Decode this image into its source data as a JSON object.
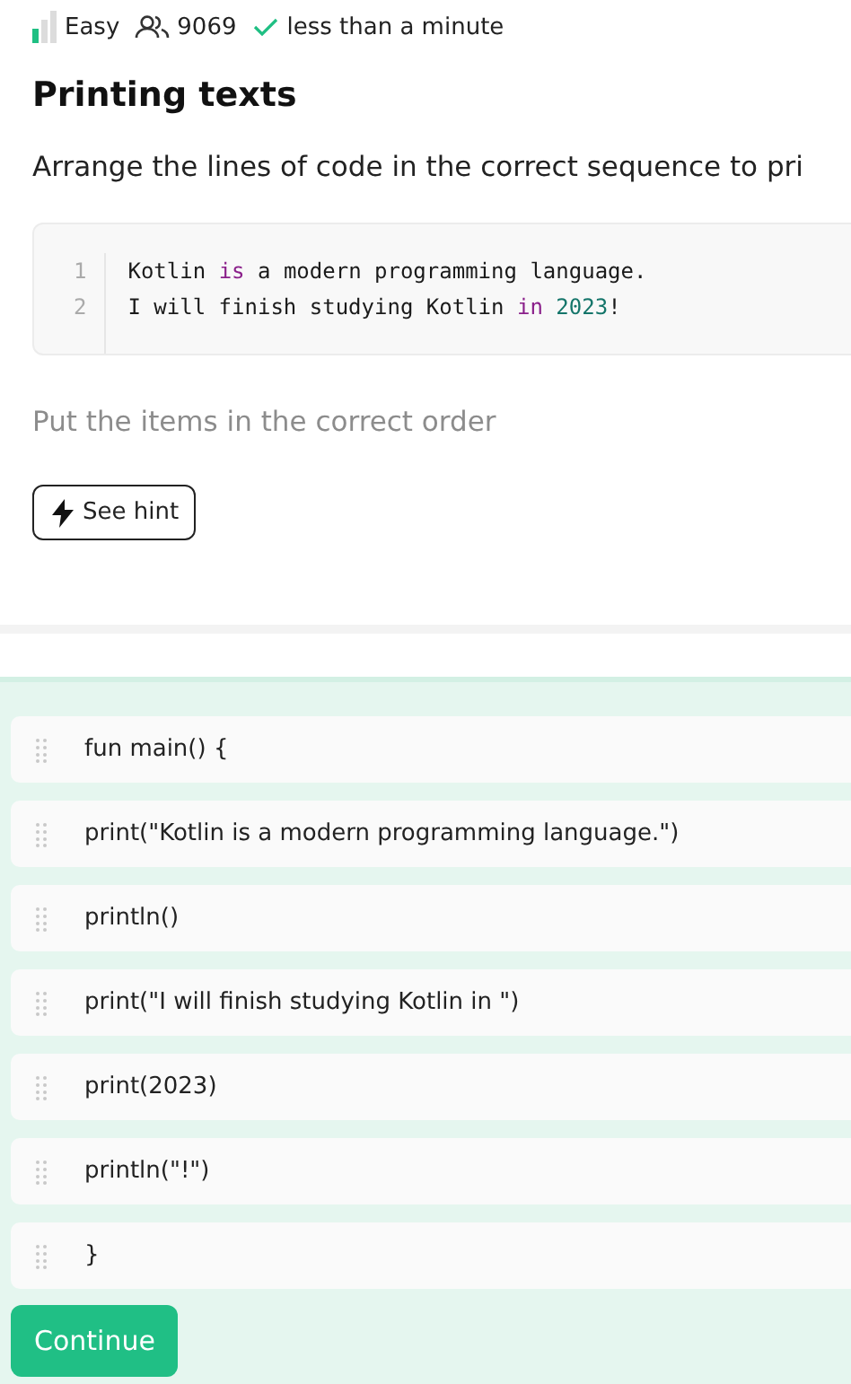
{
  "meta": {
    "difficulty": "Easy",
    "level": 0.33,
    "solved_count": "9069",
    "duration": "less than a minute"
  },
  "title": "Printing texts",
  "description": "Arrange the lines of code in the correct sequence to pri",
  "code": {
    "lines": [
      {
        "number": "1",
        "tokens": [
          {
            "text": "Kotlin ",
            "kind": "plain"
          },
          {
            "text": "is",
            "kind": "keyword"
          },
          {
            "text": " a modern programming language.",
            "kind": "plain"
          }
        ]
      },
      {
        "number": "2",
        "tokens": [
          {
            "text": "I will finish studying Kotlin ",
            "kind": "plain"
          },
          {
            "text": "in",
            "kind": "keyword"
          },
          {
            "text": " 2023",
            "kind": "number"
          },
          {
            "text": "!",
            "kind": "plain"
          }
        ]
      }
    ]
  },
  "instruction": "Put the items in the correct order",
  "hint_button": "See hint",
  "items": [
    {
      "text": "fun main() {"
    },
    {
      "text": "print(\"Kotlin is a modern programming language.\")"
    },
    {
      "text": "println()"
    },
    {
      "text": "print(\"I will finish studying Kotlin in \")"
    },
    {
      "text": "print(2023)"
    },
    {
      "text": "println(\"!\")"
    },
    {
      "text": "}"
    }
  ],
  "continue_button": "Continue"
}
